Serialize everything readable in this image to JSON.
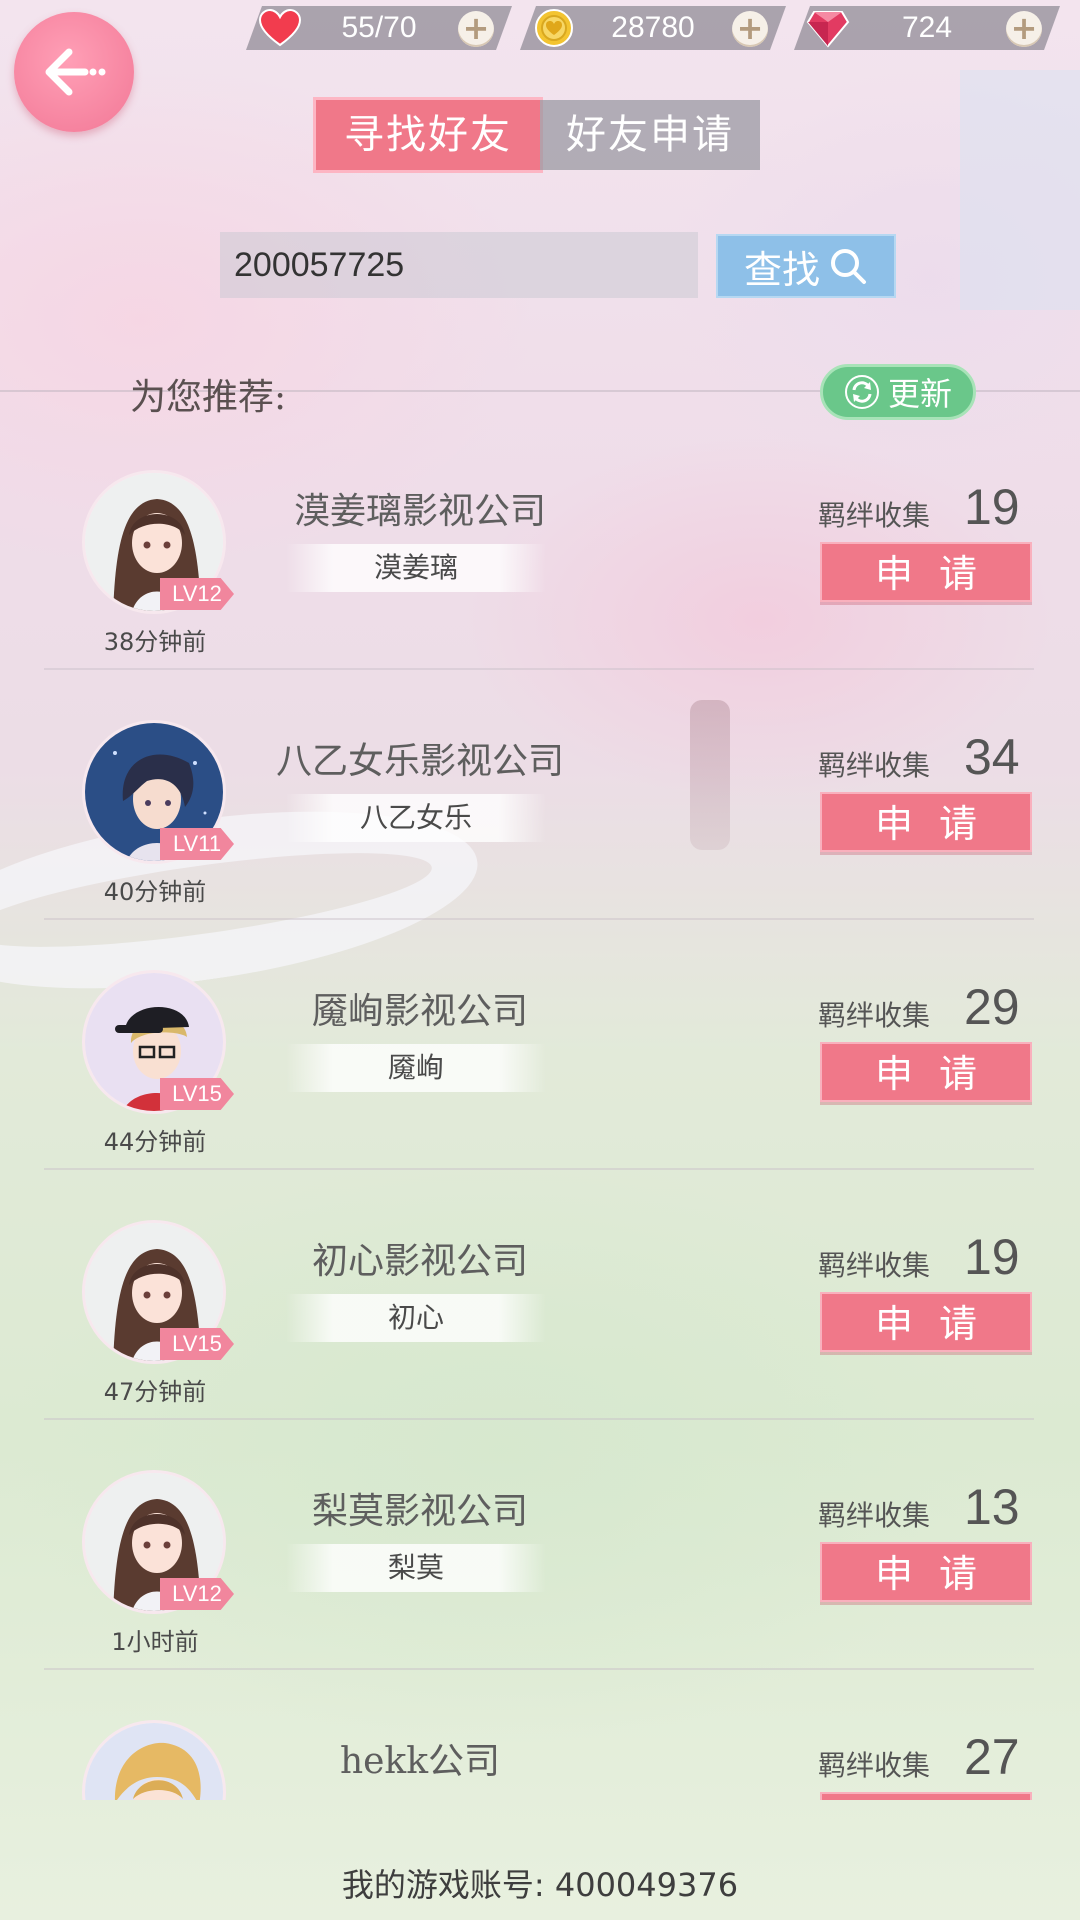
{
  "resources": {
    "stamina": "55/70",
    "gold": "28780",
    "diamonds": "724"
  },
  "tabs": [
    {
      "label": "寻找好友",
      "active": true
    },
    {
      "label": "好友申请",
      "active": false
    }
  ],
  "search": {
    "value": "200057725",
    "button_label": "查找"
  },
  "recommend": {
    "label": "为您推荐:",
    "refresh_label": "更新"
  },
  "friends": [
    {
      "company": "漠姜璃影视公司",
      "player": "漠姜璃",
      "level": "LV12",
      "time": "38分钟前",
      "bond_label": "羁绊收集",
      "bond": "19",
      "apply_label": "申请",
      "avatar": "girl"
    },
    {
      "company": "八乙女乐影视公司",
      "player": "八乙女乐",
      "level": "LV11",
      "time": "40分钟前",
      "bond_label": "羁绊收集",
      "bond": "34",
      "apply_label": "申请",
      "avatar": "boy-blue"
    },
    {
      "company": "魇峋影视公司",
      "player": "魇峋",
      "level": "LV15",
      "time": "44分钟前",
      "bond_label": "羁绊收集",
      "bond": "29",
      "apply_label": "申请",
      "avatar": "boy-cap"
    },
    {
      "company": "初心影视公司",
      "player": "初心",
      "level": "LV15",
      "time": "47分钟前",
      "bond_label": "羁绊收集",
      "bond": "19",
      "apply_label": "申请",
      "avatar": "girl"
    },
    {
      "company": "梨莫影视公司",
      "player": "梨莫",
      "level": "LV12",
      "time": "1小时前",
      "bond_label": "羁绊收集",
      "bond": "13",
      "apply_label": "申请",
      "avatar": "girl"
    },
    {
      "company": "hekk公司",
      "bond_label": "羁绊收集",
      "bond": "27",
      "avatar": "boy-blond"
    }
  ],
  "account": {
    "label": "我的游戏账号: 400049376"
  },
  "colors": {
    "accent_pink": "#f07889",
    "search_blue": "#8ec0e8",
    "refresh_green": "#6ac78a"
  }
}
